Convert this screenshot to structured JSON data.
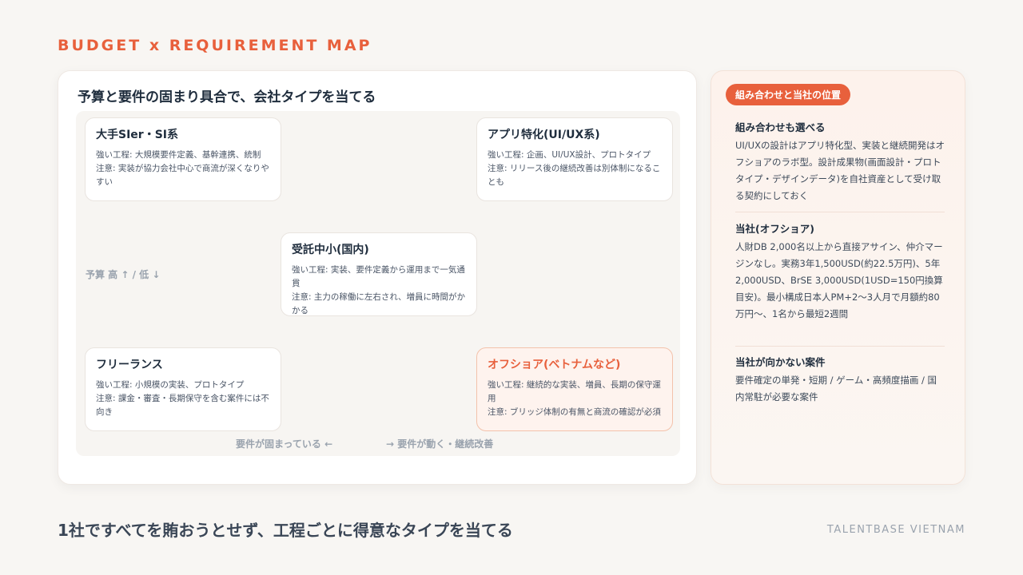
{
  "eyebrow": "BUDGET x REQUIREMENT MAP",
  "main": {
    "title": "予算と要件の固まり具合で、会社タイプを当てる",
    "quadrants": [
      {
        "title": "大手SIer・SI系",
        "strength": "強い工程: 大規模要件定義、基幹連携、統制",
        "caution": "注意: 実装が協力会社中心で商流が深くなりやすい"
      },
      {
        "title": "アプリ特化(UI/UX系)",
        "strength": "強い工程: 企画、UI/UX設計、プロトタイプ",
        "caution": "注意: リリース後の継続改善は別体制になることも"
      },
      {
        "title": "受託中小(国内)",
        "strength": "強い工程: 実装、要件定義から運用まで一気通貫",
        "caution": "注意: 主力の稼働に左右され、増員に時間がかかる"
      },
      {
        "title": "フリーランス",
        "strength": "強い工程: 小規模の実装、プロトタイプ",
        "caution": "注意: 課金・審査・長期保守を含む案件には不向き"
      },
      {
        "title": "オフショア(ベトナムなど)",
        "strength": "強い工程: 継続的な実装、増員、長期の保守運用",
        "caution": "注意: ブリッジ体制の有無と商流の確認が必須"
      }
    ],
    "axis_y": "予算 高 ↑ / 低 ↓",
    "axis_x_left": "要件が固まっている ←",
    "axis_x_right": "→ 要件が動く・継続改善"
  },
  "side": {
    "pill": "組み合わせと当社の位置",
    "sections": [
      {
        "heading": "組み合わせも選べる",
        "body": "UI/UXの設計はアプリ特化型、実装と継続開発はオフショアのラボ型。設計成果物(画面設計・プロトタイプ・デザインデータ)を自社資産として受け取る契約にしておく"
      },
      {
        "heading": "当社(オフショア)",
        "body": "人財DB 2,000名以上から直接アサイン、仲介マージンなし。実務3年1,500USD(約22.5万円)、5年2,000USD、BrSE 3,000USD(1USD=150円換算目安)。最小構成日本人PM+2〜3人月で月額約80万円〜、1名から最短2週間"
      },
      {
        "heading": "当社が向かない案件",
        "body": "要件確定の単発・短期 / ゲーム・高頻度描画 / 国内常駐が必要な案件"
      }
    ]
  },
  "footer": {
    "tagline": "1社ですべてを賄おうとせず、工程ごとに得意なタイプを当てる",
    "brand": "TALENTBASE VIETNAM"
  },
  "colors": {
    "accent": "#e8603c",
    "background": "#f8f6f3",
    "text": "#1f2d3d",
    "muted": "#9aa3ae"
  }
}
